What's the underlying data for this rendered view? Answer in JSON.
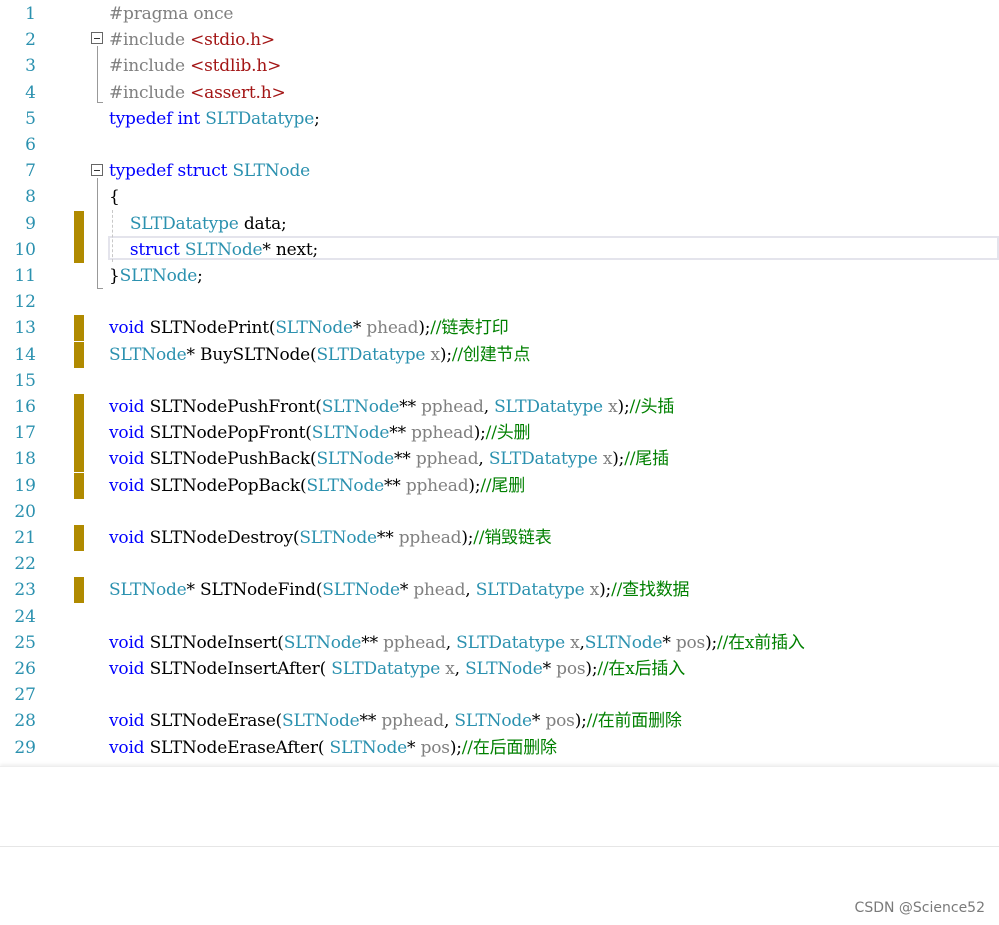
{
  "editor": {
    "lines": [
      {
        "n": "1",
        "tokens": [
          [
            "pp",
            "#pragma once"
          ]
        ]
      },
      {
        "n": "2",
        "tokens": [
          [
            "pp",
            "#include "
          ],
          [
            "str",
            "<stdio.h>"
          ]
        ]
      },
      {
        "n": "3",
        "tokens": [
          [
            "pp",
            "#include "
          ],
          [
            "str",
            "<stdlib.h>"
          ]
        ]
      },
      {
        "n": "4",
        "tokens": [
          [
            "pp",
            "#include "
          ],
          [
            "str",
            "<assert.h>"
          ]
        ]
      },
      {
        "n": "5",
        "tokens": [
          [
            "kw",
            "typedef"
          ],
          [
            "fn",
            " "
          ],
          [
            "kw",
            "int"
          ],
          [
            "fn",
            " "
          ],
          [
            "ty",
            "SLTDatatype"
          ],
          [
            "fn",
            ";"
          ]
        ]
      },
      {
        "n": "6",
        "tokens": []
      },
      {
        "n": "7",
        "tokens": [
          [
            "kw",
            "typedef"
          ],
          [
            "fn",
            " "
          ],
          [
            "kw",
            "struct"
          ],
          [
            "fn",
            " "
          ],
          [
            "ty",
            "SLTNode"
          ]
        ]
      },
      {
        "n": "8",
        "tokens": [
          [
            "fn",
            "{"
          ]
        ]
      },
      {
        "n": "9",
        "tokens": [
          [
            "fn",
            "    "
          ],
          [
            "ty",
            "SLTDatatype"
          ],
          [
            "fn",
            " data;"
          ]
        ]
      },
      {
        "n": "10",
        "tokens": [
          [
            "fn",
            "    "
          ],
          [
            "kw",
            "struct"
          ],
          [
            "fn",
            " "
          ],
          [
            "ty",
            "SLTNode"
          ],
          [
            "fn",
            "* next;"
          ]
        ]
      },
      {
        "n": "11",
        "tokens": [
          [
            "fn",
            "}"
          ],
          [
            "ty",
            "SLTNode"
          ],
          [
            "fn",
            ";"
          ]
        ]
      },
      {
        "n": "12",
        "tokens": []
      },
      {
        "n": "13",
        "tokens": [
          [
            "kw",
            "void"
          ],
          [
            "fn",
            " SLTNodePrint("
          ],
          [
            "ty",
            "SLTNode"
          ],
          [
            "fn",
            "* "
          ],
          [
            "pa",
            "phead"
          ],
          [
            "fn",
            ");"
          ],
          [
            "cm",
            "//链表打印"
          ]
        ]
      },
      {
        "n": "14",
        "tokens": [
          [
            "ty",
            "SLTNode"
          ],
          [
            "fn",
            "* BuySLTNode("
          ],
          [
            "ty",
            "SLTDatatype"
          ],
          [
            "fn",
            " "
          ],
          [
            "pa",
            "x"
          ],
          [
            "fn",
            ");"
          ],
          [
            "cm",
            "//创建节点"
          ]
        ]
      },
      {
        "n": "15",
        "tokens": []
      },
      {
        "n": "16",
        "tokens": [
          [
            "kw",
            "void"
          ],
          [
            "fn",
            " SLTNodePushFront("
          ],
          [
            "ty",
            "SLTNode"
          ],
          [
            "fn",
            "** "
          ],
          [
            "pa",
            "pphead"
          ],
          [
            "fn",
            ", "
          ],
          [
            "ty",
            "SLTDatatype"
          ],
          [
            "fn",
            " "
          ],
          [
            "pa",
            "x"
          ],
          [
            "fn",
            ");"
          ],
          [
            "cm",
            "//头插"
          ]
        ]
      },
      {
        "n": "17",
        "tokens": [
          [
            "kw",
            "void"
          ],
          [
            "fn",
            " SLTNodePopFront("
          ],
          [
            "ty",
            "SLTNode"
          ],
          [
            "fn",
            "** "
          ],
          [
            "pa",
            "pphead"
          ],
          [
            "fn",
            ");"
          ],
          [
            "cm",
            "//头删"
          ]
        ]
      },
      {
        "n": "18",
        "tokens": [
          [
            "kw",
            "void"
          ],
          [
            "fn",
            " SLTNodePushBack("
          ],
          [
            "ty",
            "SLTNode"
          ],
          [
            "fn",
            "** "
          ],
          [
            "pa",
            "pphead"
          ],
          [
            "fn",
            ", "
          ],
          [
            "ty",
            "SLTDatatype"
          ],
          [
            "fn",
            " "
          ],
          [
            "pa",
            "x"
          ],
          [
            "fn",
            ");"
          ],
          [
            "cm",
            "//尾插"
          ]
        ]
      },
      {
        "n": "19",
        "tokens": [
          [
            "kw",
            "void"
          ],
          [
            "fn",
            " SLTNodePopBack("
          ],
          [
            "ty",
            "SLTNode"
          ],
          [
            "fn",
            "** "
          ],
          [
            "pa",
            "pphead"
          ],
          [
            "fn",
            ");"
          ],
          [
            "cm",
            "//尾删"
          ]
        ]
      },
      {
        "n": "20",
        "tokens": []
      },
      {
        "n": "21",
        "tokens": [
          [
            "kw",
            "void"
          ],
          [
            "fn",
            " SLTNodeDestroy("
          ],
          [
            "ty",
            "SLTNode"
          ],
          [
            "fn",
            "** "
          ],
          [
            "pa",
            "pphead"
          ],
          [
            "fn",
            ");"
          ],
          [
            "cm",
            "//销毁链表"
          ]
        ]
      },
      {
        "n": "22",
        "tokens": []
      },
      {
        "n": "23",
        "tokens": [
          [
            "ty",
            "SLTNode"
          ],
          [
            "fn",
            "* SLTNodeFind("
          ],
          [
            "ty",
            "SLTNode"
          ],
          [
            "fn",
            "* "
          ],
          [
            "pa",
            "phead"
          ],
          [
            "fn",
            ", "
          ],
          [
            "ty",
            "SLTDatatype"
          ],
          [
            "fn",
            " "
          ],
          [
            "pa",
            "x"
          ],
          [
            "fn",
            ");"
          ],
          [
            "cm",
            "//查找数据"
          ]
        ]
      },
      {
        "n": "24",
        "tokens": []
      },
      {
        "n": "25",
        "tokens": [
          [
            "kw",
            "void"
          ],
          [
            "fn",
            " SLTNodeInsert("
          ],
          [
            "ty",
            "SLTNode"
          ],
          [
            "fn",
            "** "
          ],
          [
            "pa",
            "pphead"
          ],
          [
            "fn",
            ", "
          ],
          [
            "ty",
            "SLTDatatype"
          ],
          [
            "fn",
            " "
          ],
          [
            "pa",
            "x"
          ],
          [
            "fn",
            ","
          ],
          [
            "ty",
            "SLTNode"
          ],
          [
            "fn",
            "* "
          ],
          [
            "pa",
            "pos"
          ],
          [
            "fn",
            ");"
          ],
          [
            "cm",
            "//在x前插入"
          ]
        ]
      },
      {
        "n": "26",
        "tokens": [
          [
            "kw",
            "void"
          ],
          [
            "fn",
            " SLTNodeInsertAfter( "
          ],
          [
            "ty",
            "SLTDatatype"
          ],
          [
            "fn",
            " "
          ],
          [
            "pa",
            "x"
          ],
          [
            "fn",
            ", "
          ],
          [
            "ty",
            "SLTNode"
          ],
          [
            "fn",
            "* "
          ],
          [
            "pa",
            "pos"
          ],
          [
            "fn",
            ");"
          ],
          [
            "cm",
            "//在x后插入"
          ]
        ]
      },
      {
        "n": "27",
        "tokens": []
      },
      {
        "n": "28",
        "tokens": [
          [
            "kw",
            "void"
          ],
          [
            "fn",
            " SLTNodeErase("
          ],
          [
            "ty",
            "SLTNode"
          ],
          [
            "fn",
            "** "
          ],
          [
            "pa",
            "pphead"
          ],
          [
            "fn",
            ", "
          ],
          [
            "ty",
            "SLTNode"
          ],
          [
            "fn",
            "* "
          ],
          [
            "pa",
            "pos"
          ],
          [
            "fn",
            ");"
          ],
          [
            "cm",
            "//在前面删除"
          ]
        ]
      },
      {
        "n": "29",
        "tokens": [
          [
            "kw",
            "void"
          ],
          [
            "fn",
            " SLTNodeEraseAfter( "
          ],
          [
            "ty",
            "SLTNode"
          ],
          [
            "fn",
            "* "
          ],
          [
            "pa",
            "pos"
          ],
          [
            "fn",
            ");"
          ],
          [
            "cm",
            "//在后面删除"
          ]
        ]
      }
    ],
    "changed_lines": [
      "9",
      "10",
      "13",
      "14",
      "16",
      "17",
      "18",
      "19",
      "21",
      "23"
    ]
  },
  "watermark": "CSDN @Science52"
}
